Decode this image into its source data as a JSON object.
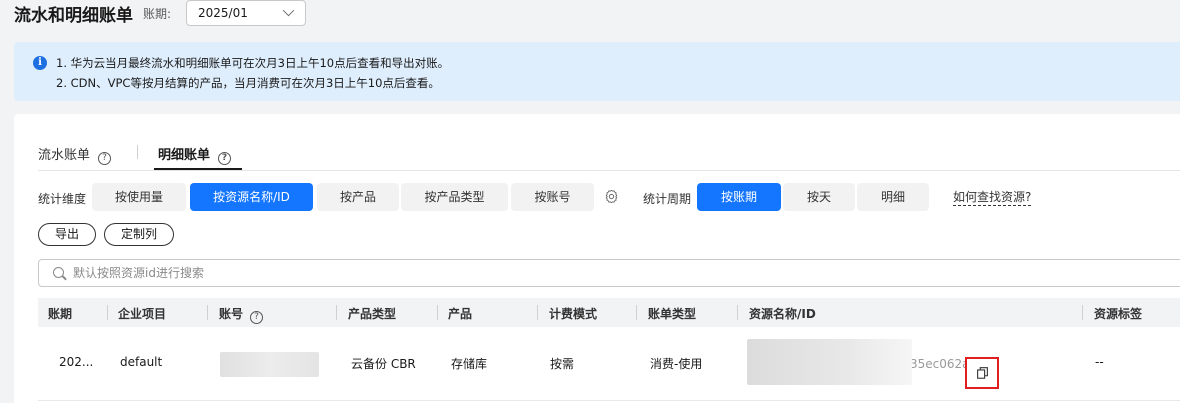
{
  "header": {
    "title": "流水和明细账单",
    "period_label": "账期:",
    "period_value": "2025/01"
  },
  "notice": {
    "icon": "info-icon",
    "lines": [
      "1. 华为云当月最终流水和明细账单可在次月3日上午10点后查看和导出对账。",
      "2. CDN、VPC等按月结算的产品，当月消费可在次月3日上午10点后查看。"
    ]
  },
  "tabs": [
    {
      "label": "流水账单",
      "active": false
    },
    {
      "label": "明细账单",
      "active": true
    }
  ],
  "filters": {
    "dimension_label": "统计维度",
    "dimension_options": [
      {
        "label": "按使用量",
        "active": false
      },
      {
        "label": "按资源名称/ID",
        "active": true
      },
      {
        "label": "按产品",
        "active": false
      },
      {
        "label": "按产品类型",
        "active": false
      },
      {
        "label": "按账号",
        "active": false
      }
    ],
    "period_label": "统计周期",
    "period_options": [
      {
        "label": "按账期",
        "active": true
      },
      {
        "label": "按天",
        "active": false
      },
      {
        "label": "明细",
        "active": false
      }
    ],
    "help_link": "如何查找资源?"
  },
  "actions": {
    "export": "导出",
    "customize": "定制列"
  },
  "search": {
    "placeholder": "默认按照资源id进行搜索"
  },
  "table": {
    "headers": [
      "账期",
      "企业项目",
      "账号",
      "产品类型",
      "产品",
      "计费模式",
      "账单类型",
      "资源名称/ID",
      "资源标签"
    ],
    "rows": [
      {
        "period": "202...",
        "enterprise_project": "default",
        "account": "",
        "product_type": "云备份 CBR",
        "product": "存储库",
        "billing_mode": "按需",
        "bill_type": "消费-使用",
        "resource_id_tail": "35ec062ab",
        "tags": "--"
      }
    ]
  },
  "colors": {
    "accent": "#1476ff",
    "highlight_border": "#e02020",
    "notice_bg": "#dfeefd"
  }
}
